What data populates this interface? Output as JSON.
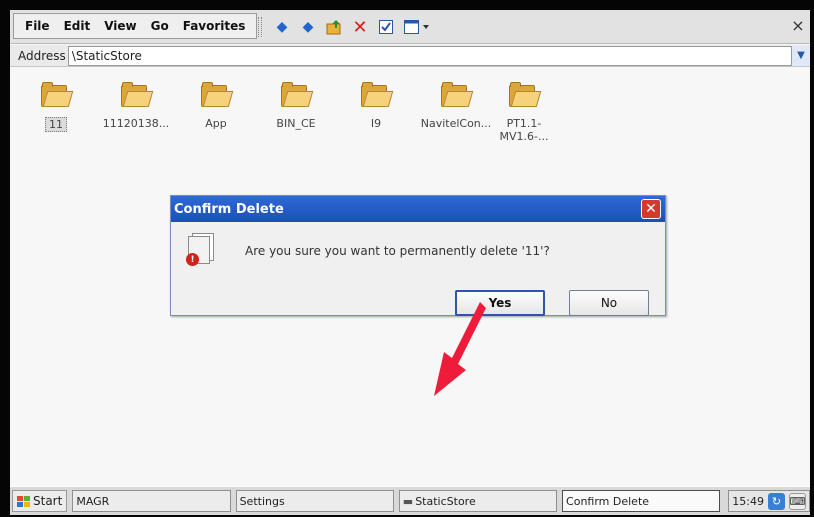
{
  "menu": [
    "File",
    "Edit",
    "View",
    "Go",
    "Favorites"
  ],
  "toolbar": {
    "buttons": [
      "back-icon",
      "forward-icon",
      "up-folder-icon",
      "delete-icon",
      "properties-icon",
      "views-icon"
    ],
    "close_glyph": "×"
  },
  "address": {
    "label": "Address",
    "value": "\\StaticStore"
  },
  "files": [
    {
      "name": "11",
      "selected": true
    },
    {
      "name": "11120138..."
    },
    {
      "name": "App"
    },
    {
      "name": "BIN_CE"
    },
    {
      "name": "I9"
    },
    {
      "name": "NavitelCon..."
    },
    {
      "name": "PT1.1-MV1.6-..."
    }
  ],
  "dialog": {
    "title": "Confirm Delete",
    "message": "Are you sure you want to permanently delete '11'?",
    "yes_label": "Yes",
    "no_label": "No",
    "close_glyph": "✕"
  },
  "taskbar": {
    "start_label": "Start",
    "tasks": [
      "MAGR",
      "Settings",
      "StaticStore",
      "Confirm Delete"
    ],
    "clock": "15:49"
  },
  "colors": {
    "title_bar": "#1d4fb4",
    "dialog_close": "#d23a2a",
    "annotation_arrow": "#ee1c3a",
    "folder": "#f6d37a"
  }
}
